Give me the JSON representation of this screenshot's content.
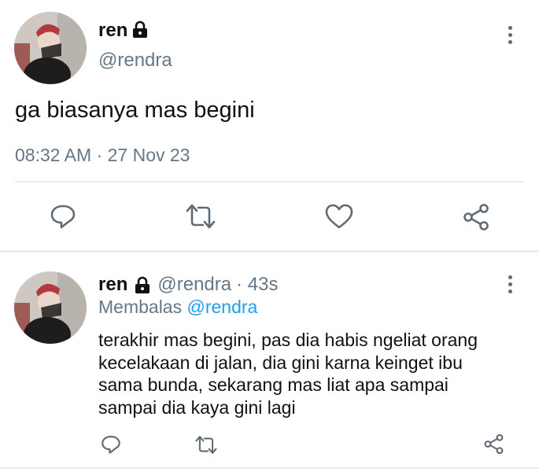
{
  "main_tweet": {
    "name": "ren",
    "handle": "@rendra",
    "text": "ga biasanya mas begini",
    "timestamp": "08:32 AM · 27 Nov 23",
    "icons": [
      "lock-icon",
      "more-icon",
      "reply-icon",
      "retweet-icon",
      "like-icon",
      "share-icon"
    ]
  },
  "reply_tweet": {
    "name": "ren",
    "handle": "@rendra",
    "time": "· 43s",
    "replying_label": "Membalas",
    "replying_handle": "@rendra",
    "text_lines": [
      "terakhir mas begini, pas dia habis ngeliat orang",
      "kecelakaan di jalan, dia gini karna keinget ibu",
      "sama bunda, sekarang mas liat apa sampai",
      "sampai dia kaya gini lagi"
    ]
  },
  "colors": {
    "accent": "#1da1f2",
    "muted": "#657786",
    "divider": "#e6ecf0"
  }
}
